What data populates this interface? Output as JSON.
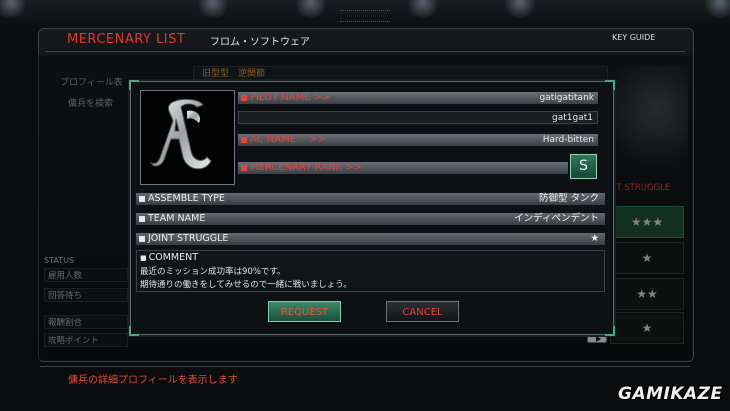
{
  "header": {
    "title": "MERCENARY LIST",
    "subtitle": "フロム・ソフトウェア",
    "key_guide": "KEY GUIDE"
  },
  "background": {
    "left": {
      "profile_btn": "プロフィール表",
      "search_btn": "傭兵を検索",
      "status_label": "STATUS",
      "rows": [
        {
          "label": "雇用人数",
          "value": ""
        },
        {
          "label": "回答待ち",
          "value": ""
        },
        {
          "label": "報酬割合",
          "value": ""
        },
        {
          "label": "攻略ポイント",
          "value": ""
        }
      ]
    },
    "top_bar": "旧型型　逆関節",
    "right": {
      "header": "NT STRUGGLE",
      "stars": [
        "★★★",
        "★",
        "★★",
        "★"
      ]
    }
  },
  "dialog": {
    "pilot_name_label": "PILOT NAME >>",
    "pilot_name": "gatigatitank",
    "pilot_id": "gat1gat1",
    "ac_name_label": "AC NAME　 >>",
    "ac_name": "Hard-bitten",
    "rank_label": "MERCENARY RANK >>",
    "rank": "S",
    "assemble_type_label": "ASSEMBLE TYPE",
    "assemble_type": "防御型 タンク",
    "team_name_label": "TEAM NAME",
    "team_name": "インディペンデント",
    "joint_struggle_label": "JOINT STRUGGLE",
    "joint_struggle": "★",
    "comment_label": "COMMENT",
    "comment_lines": [
      "最近のミッション成功率は90%です。",
      "期待通りの働きをしてみせるので一緒に戦いましょう。"
    ],
    "request_button": "REQUEST",
    "cancel_button": "CANCEL"
  },
  "footer": {
    "help_text": "傭兵の詳細プロフィールを表示します"
  },
  "watermark": "GAMIKAZE",
  "colors": {
    "accent_red": "#e4443a",
    "accent_green": "#3a8c68"
  }
}
